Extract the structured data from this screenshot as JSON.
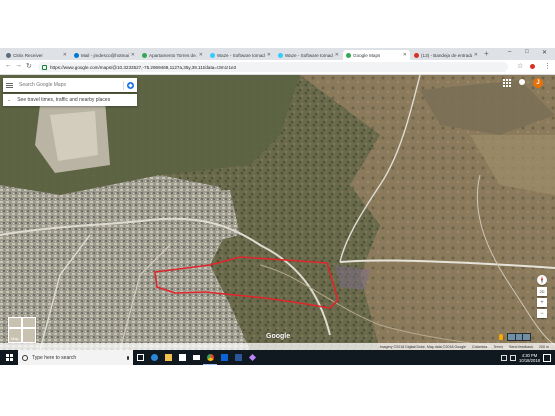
{
  "browser": {
    "tabs": [
      {
        "label": "Citrix Receiver",
        "favicon_color": "#5e6a7d",
        "active": false
      },
      {
        "label": "Mail - jmdesco@hotmail.com",
        "favicon_color": "#0078d4",
        "active": false
      },
      {
        "label": "Apartamento Torres de…",
        "favicon_color": "#34a853",
        "active": false
      },
      {
        "label": "Waze - Software tomado…",
        "favicon_color": "#33ccff",
        "active": false
      },
      {
        "label": "Waze - Software tomado…",
        "favicon_color": "#33ccff",
        "active": false
      },
      {
        "label": "Google Maps",
        "favicon_color": "#34a853",
        "active": true
      },
      {
        "label": "(13) - Bandeja de entrada",
        "favicon_color": "#d93025",
        "active": false
      }
    ],
    "new_tab_symbol": "+",
    "window_controls": [
      "–",
      "□",
      "✕"
    ],
    "nav": {
      "back": "←",
      "forward": "→",
      "reload": "↻"
    },
    "url": "https://www.google.com/maps/@10.3233527,-75.2969469,1127a,35y,39.11t/data=!3m1!1e3",
    "star": "☆",
    "menu": "⋮"
  },
  "maps": {
    "search_placeholder": "Search Google Maps",
    "explore_text": "See travel times, traffic and nearby places",
    "explore_chevron": "⌄",
    "avatar_initial": "J",
    "google_logo": "Google",
    "map_thumb_label": "Map",
    "zoom_in": "+",
    "zoom_out": "−",
    "view_2d": "2D",
    "attribution": [
      "Imagery ©2018 DigitalGlobe, Map data ©2018 Google",
      "Colombia",
      "Terms",
      "Send feedback",
      "200 m"
    ],
    "boundary_color": "#e0262b"
  },
  "taskbar": {
    "search_text": "Type here to search",
    "apps": [
      {
        "name": "task-view",
        "color": "#ffffff"
      },
      {
        "name": "edge",
        "color": "#2b88d8"
      },
      {
        "name": "file-explorer",
        "color": "#f2c14e"
      },
      {
        "name": "store",
        "color": "#ffffff"
      },
      {
        "name": "mail",
        "color": "#ffffff"
      },
      {
        "name": "chrome",
        "color": "#34a853"
      },
      {
        "name": "outlook",
        "color": "#0a64d8"
      },
      {
        "name": "word",
        "color": "#2b579a"
      },
      {
        "name": "photos",
        "color": "#bb86fc"
      }
    ],
    "time": "4:30 PM",
    "date": "10/18/2018"
  }
}
